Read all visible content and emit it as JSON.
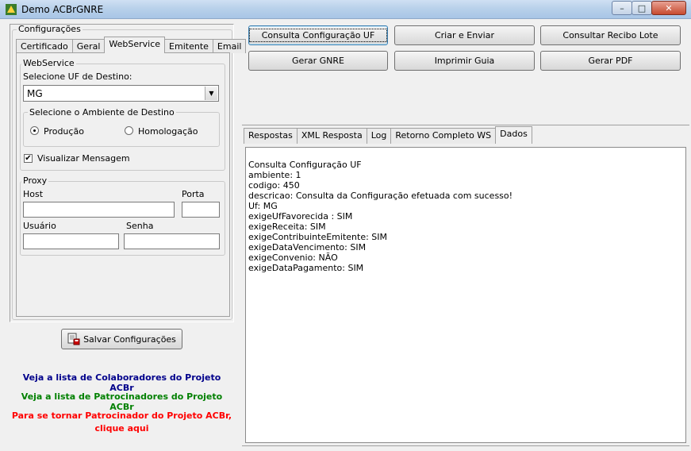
{
  "window": {
    "title": "Demo ACBrGNRE",
    "minimize": "–",
    "maximize": "□",
    "close": "✕"
  },
  "config": {
    "group_label": "Configurações",
    "tabs": [
      "Certificado",
      "Geral",
      "WebService",
      "Emitente",
      "Email"
    ],
    "active_tab": "WebService",
    "webservice": {
      "group_label": "WebService",
      "uf_label": "Selecione UF de Destino:",
      "uf_value": "MG",
      "ambiente": {
        "group_label": "Selecione o Ambiente de Destino",
        "producao": "Produção",
        "homologacao": "Homologação",
        "selected": "Produção"
      },
      "visualizar_label": "Visualizar Mensagem",
      "visualizar_checked": "✔"
    },
    "proxy": {
      "group_label": "Proxy",
      "host_label": "Host",
      "porta_label": "Porta",
      "usuario_label": "Usuário",
      "senha_label": "Senha",
      "host_value": "",
      "porta_value": "",
      "usuario_value": "",
      "senha_value": ""
    },
    "save_button": "Salvar Configurações"
  },
  "links": {
    "colaboradores": "Veja a lista de Colaboradores do Projeto ACBr",
    "patrocinadores": "Veja a lista de Patrocinadores do Projeto ACBr",
    "tornar_line1": "Para se tornar Patrocinador do Projeto ACBr,",
    "tornar_line2": "clique aqui",
    "colors": {
      "colaboradores": "#00008b",
      "patrocinadores": "#008000",
      "tornar": "#ff0000"
    }
  },
  "actions": {
    "consulta_uf": "Consulta Configuração UF",
    "criar_enviar": "Criar e Enviar",
    "consultar_recibo": "Consultar Recibo Lote",
    "gerar_gnre": "Gerar GNRE",
    "imprimir_guia": "Imprimir Guia",
    "gerar_pdf": "Gerar PDF"
  },
  "result_tabs": [
    "Respostas",
    "XML Resposta",
    "Log",
    "Retorno Completo WS",
    "Dados"
  ],
  "active_result_tab": "Dados",
  "dados_lines": [
    "Consulta Configuração UF",
    "ambiente: 1",
    "codigo: 450",
    "descricao: Consulta da Configuração efetuada com sucesso!",
    "Uf: MG",
    "exigeUfFavorecida : SIM",
    "exigeReceita: SIM",
    "exigeContribuinteEmitente: SIM",
    "exigeDataVencimento: SIM",
    "exigeConvenio: NÃO",
    "exigeDataPagamento: SIM"
  ]
}
